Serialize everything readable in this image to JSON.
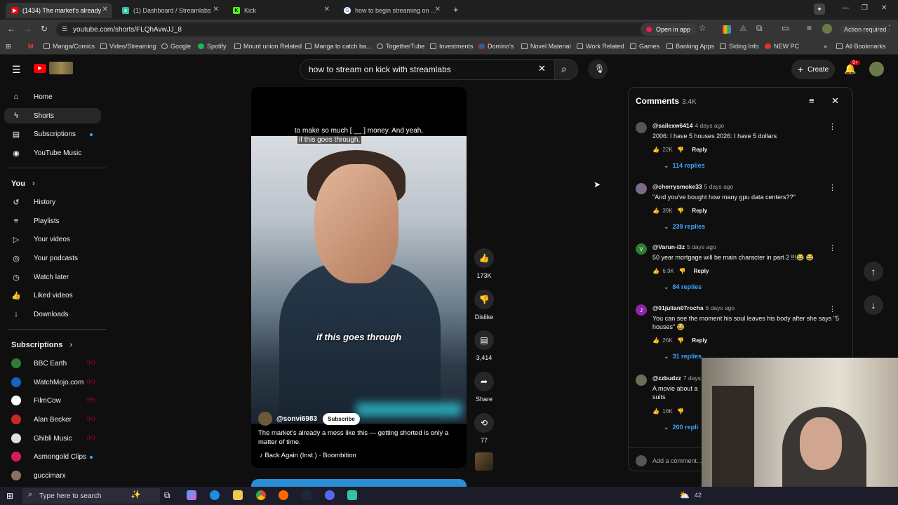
{
  "browser": {
    "tabs": [
      {
        "label": "(1434) The market's already",
        "icon": "youtube-icon",
        "active": true
      },
      {
        "label": "(1) Dashboard / Streamlabs",
        "icon": "streamlabs-icon",
        "active": false
      },
      {
        "label": "Kick",
        "icon": "kick-icon",
        "active": false
      },
      {
        "label": "how to begin streaming on kick",
        "icon": "google-icon",
        "active": false
      }
    ],
    "url": "youtube.com/shorts/FLQhAvwJJ_8",
    "open_in_app": "Open in app",
    "action_required": "Action required",
    "bookmarks": [
      "Manga/Comics",
      "Video/Streaming",
      "Google",
      "Spotify",
      "Mount union Related",
      "Manga to catch ba...",
      "TogetherTube",
      "Investments",
      "Domino's",
      "Novel Material",
      "Work Related",
      "Games",
      "Banking Apps",
      "Siding Info",
      "NEW PC"
    ],
    "all_bookmarks": "All Bookmarks"
  },
  "header": {
    "search_value": "how to stream on kick with streamlabs",
    "create_label": "Create",
    "notif_count": "9+"
  },
  "sidebar": {
    "main": [
      {
        "label": "Home",
        "icon": "home-icon"
      },
      {
        "label": "Shorts",
        "icon": "shorts-icon"
      },
      {
        "label": "Subscriptions",
        "icon": "subscriptions-icon"
      },
      {
        "label": "YouTube Music",
        "icon": "youtube-music-icon"
      }
    ],
    "you_heading": "You",
    "you": [
      {
        "label": "History",
        "icon": "history-icon"
      },
      {
        "label": "Playlists",
        "icon": "playlists-icon"
      },
      {
        "label": "Your videos",
        "icon": "your-videos-icon"
      },
      {
        "label": "Your podcasts",
        "icon": "podcasts-icon"
      },
      {
        "label": "Watch later",
        "icon": "watch-later-icon"
      },
      {
        "label": "Liked videos",
        "icon": "liked-videos-icon"
      },
      {
        "label": "Downloads",
        "icon": "downloads-icon"
      }
    ],
    "subs_heading": "Subscriptions",
    "subscriptions": [
      {
        "label": "BBC Earth",
        "color": "#2e7d32"
      },
      {
        "label": "WatchMojo.com",
        "color": "#1565c0"
      },
      {
        "label": "FilmCow",
        "color": "#ffffff"
      },
      {
        "label": "Alan Becker",
        "color": "#c62828"
      },
      {
        "label": "Ghibli Music",
        "color": "#e0e0e0"
      },
      {
        "label": "Asmongold Clips",
        "color": "#d81b60"
      },
      {
        "label": "guccimarx",
        "color": "#8d6e63"
      }
    ]
  },
  "video": {
    "caption_top_1": "to make so much [ __ ] money. And yeah,",
    "caption_top_2": "if this goes through,",
    "caption_center": "if this goes through",
    "channel": "@sonvi6983",
    "subscribe": "Subscribe",
    "description": "The market's already a mess like this — getting shorted is only a matter of time.",
    "song": "Back Again (Inst.) · Boombition",
    "progress": 0.8
  },
  "actions": {
    "likes": "173K",
    "dislike": "Dislike",
    "comments": "3,414",
    "share": "Share",
    "remix": "77"
  },
  "comments": {
    "title": "Comments",
    "count": "3.4K",
    "add_placeholder": "Add a comment...",
    "items": [
      {
        "user": "@sailexw6414",
        "time": "4 days ago",
        "text": "2006: I have 5 houses  2026: I have 5 dollars",
        "likes": "22K",
        "replies": "114 replies",
        "avatar": "",
        "color": "#555"
      },
      {
        "user": "@cherrysmoke33",
        "time": "5 days ago",
        "text": "\"And you've bought how many gpu data centers??\"",
        "likes": "39K",
        "replies": "239 replies",
        "avatar": "",
        "color": "#7b6a8a"
      },
      {
        "user": "@Varun-i3z",
        "time": "5 days ago",
        "text": "50 year mortgage will be main character in part 2 !!!😂 😂",
        "likes": "6.9K",
        "replies": "84 replies",
        "avatar": "V",
        "color": "#2e7d32"
      },
      {
        "user": "@01julian07rocha",
        "time": "6 days ago",
        "text": "You can see the moment his soul leaves his body after she says \"5 houses\" 😂",
        "likes": "26K",
        "replies": "31 replies",
        "avatar": "J",
        "color": "#8e24aa"
      },
      {
        "user": "@zzbudzz",
        "time": "7 days a",
        "text": "A movie about a suits",
        "likes": "16K",
        "replies": "200 repli",
        "avatar": "",
        "color": "#6d6d5a"
      }
    ],
    "reply_label": "Reply"
  },
  "taskbar": {
    "search_placeholder": "Type here to search",
    "tray_text": "42"
  }
}
